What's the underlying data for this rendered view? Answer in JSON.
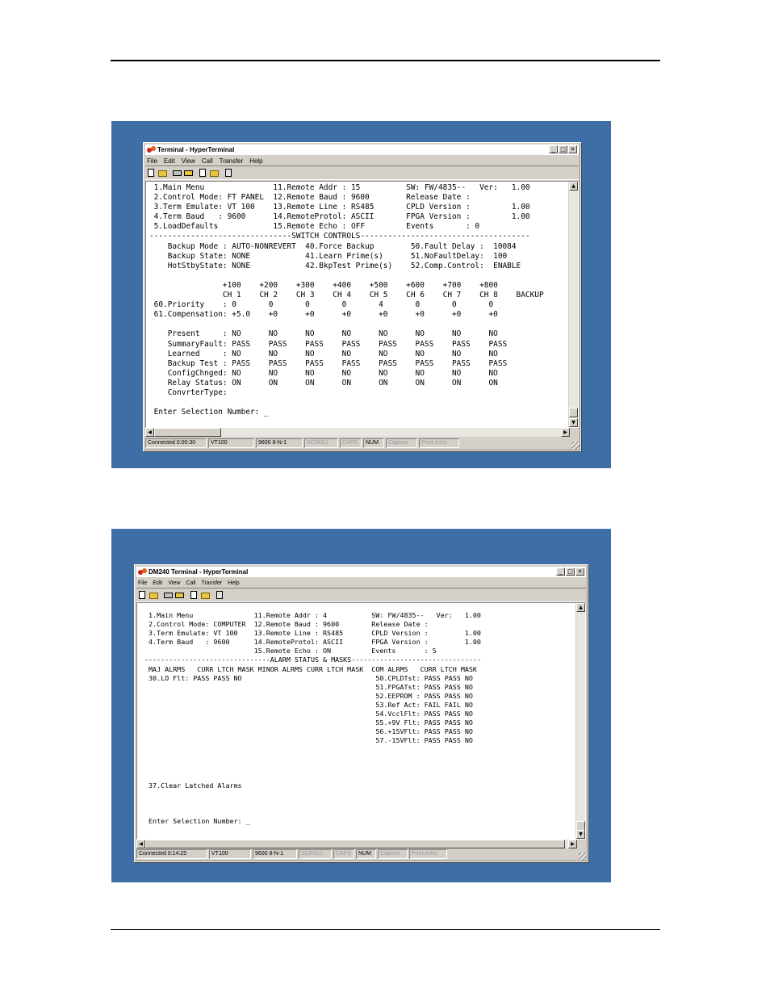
{
  "windows": [
    {
      "title": "Terminal - HyperTerminal",
      "menu": [
        "File",
        "Edit",
        "View",
        "Call",
        "Transfer",
        "Help"
      ],
      "lines": [
        " 1.Main Menu               11.Remote Addr : 15          SW: FW/4835--   Ver:   1.00",
        " 2.Control Mode: FT PANEL  12.Remote Baud : 9600        Release Date :",
        " 3.Term Emulate: VT 100    13.Remote Line : RS485       CPLD Version :         1.00",
        " 4.Term Baud   : 9600      14.RemoteProtol: ASCII       FPGA Version :         1.00",
        " 5.LoadDefaults            15.Remote Echo : OFF         Events       : 0",
        "-------------------------------SWITCH CONTROLS-------------------------------------",
        "    Backup Mode : AUTO-NONREVERT  40.Force Backup        50.Fault Delay :  10084",
        "    Backup State: NONE            41.Learn Prime(s)      51.NoFaultDelay:  100",
        "    HotStbyState: NONE            42.BkpTest Prime(s)    52.Comp.Control:  ENABLE",
        "",
        "                +100    +200    +300    +400    +500    +600    +700    +800",
        "                CH 1    CH 2    CH 3    CH 4    CH 5    CH 6    CH 7    CH 8    BACKUP",
        " 60.Priority    : 0       0       0       0       4       0       0       0",
        " 61.Compensation: +5.0    +0      +0      +0      +0      +0      +0      +0",
        "",
        "    Present     : NO      NO      NO      NO      NO      NO      NO      NO",
        "    SummaryFault: PASS    PASS    PASS    PASS    PASS    PASS    PASS    PASS",
        "    Learned     : NO      NO      NO      NO      NO      NO      NO      NO",
        "    Backup Test : PASS    PASS    PASS    PASS    PASS    PASS    PASS    PASS",
        "    ConfigChnged: NO      NO      NO      NO      NO      NO      NO      NO",
        "    Relay Status: ON      ON      ON      ON      ON      ON      ON      ON",
        "    ConvrterType:",
        "",
        " Enter Selection Number: _"
      ],
      "status": [
        "Connected 0:00:30",
        "VT100",
        "9600 8-N-1",
        "SCROLL",
        "CAPS",
        "NUM",
        "Capture",
        "Print echo"
      ]
    },
    {
      "title": "DM240 Terminal - HyperTerminal",
      "menu": [
        "File",
        "Edit",
        "View",
        "Call",
        "Transfer",
        "Help"
      ],
      "lines": [
        " 1.Main Menu               11.Remote Addr : 4           SW: FW/4835--   Ver:   1.00",
        " 2.Control Mode: COMPUTER  12.Remote Baud : 9600        Release Date :",
        " 3.Term Emulate: VT 100    13.Remote Line : RS485       CPLD Version :         1.00",
        " 4.Term Baud   : 9600      14.RemoteProtol: ASCII       FPGA Version :         1.00",
        "                           15.Remote Echo : ON          Events       : 5",
        "-------------------------------ALARM STATUS & MASKS--------------------------------",
        " MAJ ALRMS   CURR LTCH MASK MINOR ALRMS CURR LTCH MASK  COM ALRMS   CURR LTCH MASK",
        " 30.LO Flt: PASS PASS NO                                 50.CPLDTst: PASS PASS NO",
        "                                                         51.FPGATst: PASS PASS NO",
        "                                                         52.EEPROM : PASS PASS NO",
        "                                                         53.Ref Act: FAIL FAIL NO",
        "                                                         54.VcclFlt: PASS PASS NO",
        "                                                         55.+9V Flt: PASS PASS NO",
        "                                                         56.+15VFlt: PASS PASS NO",
        "                                                         57.-15VFlt: PASS PASS NO",
        "",
        "",
        "",
        "",
        " 37.Clear Latched Alarms",
        "",
        "",
        "",
        " Enter Selection Number: _"
      ],
      "status": [
        "Connected 0:14:25",
        "VT100",
        "9600 8-N-1",
        "SCROLL",
        "CAPS",
        "NUM",
        "Capture",
        "Print echo"
      ]
    }
  ]
}
